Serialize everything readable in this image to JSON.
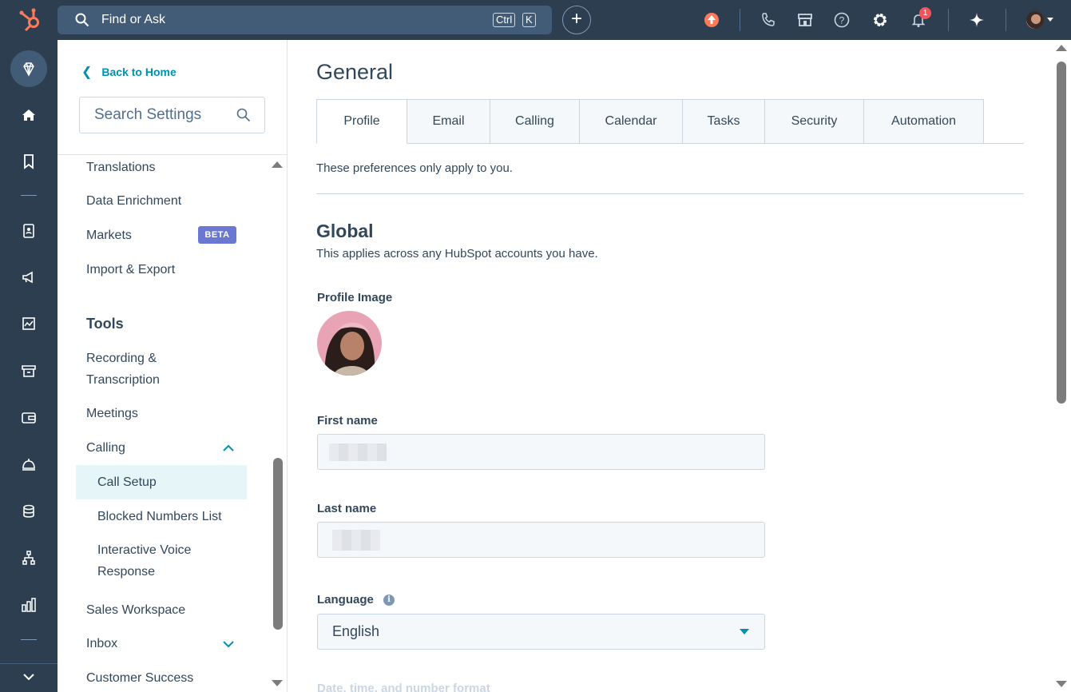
{
  "topbar": {
    "search_text": "Find or Ask",
    "shortcut_ctrl": "Ctrl",
    "shortcut_k": "K",
    "notification_count": "1",
    "icons": [
      "upgrade-icon",
      "phone-icon",
      "marketplace-icon",
      "help-icon",
      "settings-icon",
      "bell-icon",
      "ai-sparkle-icon",
      "account-avatar"
    ]
  },
  "leftnav": {
    "icons": [
      "hubspot-logo",
      "diamond-icon",
      "home-icon",
      "bookmark-icon",
      "contacts-icon",
      "marketing-icon",
      "content-icon",
      "commerce-icon",
      "payments-icon",
      "service-icon",
      "data-icon",
      "automation-icon",
      "reporting-icon",
      "collapse-icon"
    ]
  },
  "sidebar": {
    "back_label": "Back to Home",
    "search_placeholder": "Search Settings",
    "items": [
      {
        "label": "Translations"
      },
      {
        "label": "Data Enrichment"
      },
      {
        "label": "Markets",
        "badge": "BETA"
      },
      {
        "label": "Import & Export"
      }
    ],
    "tools_heading": "Tools",
    "tools_items": [
      {
        "label": "Recording &"
      },
      {
        "label": "Transcription"
      },
      {
        "label": "Meetings"
      },
      {
        "label": "Calling"
      },
      {
        "label": "Call Setup"
      },
      {
        "label": "Blocked Numbers List"
      },
      {
        "label": "Interactive Voice"
      },
      {
        "label": "Response"
      },
      {
        "label": "Sales Workspace"
      },
      {
        "label": "Inbox"
      },
      {
        "label": "Customer Success"
      }
    ]
  },
  "main": {
    "title": "General",
    "tabs": [
      {
        "label": "Profile"
      },
      {
        "label": "Email"
      },
      {
        "label": "Calling"
      },
      {
        "label": "Calendar"
      },
      {
        "label": "Tasks"
      },
      {
        "label": "Security"
      },
      {
        "label": "Automation"
      }
    ],
    "prefs_note": "These preferences only apply to you.",
    "global_heading": "Global",
    "global_desc": "This applies across any HubSpot accounts you have.",
    "profile_image_label": "Profile Image",
    "first_name_label": "First name",
    "first_name_value": "",
    "last_name_label": "Last name",
    "last_name_value": "",
    "language_label": "Language",
    "language_value": "English",
    "date_format_label": "Date, time, and number format"
  },
  "colors": {
    "topbar_bg": "#2d3e50",
    "accent": "#0091ae",
    "beta_badge": "#6a78d1",
    "notification": "#f2545b",
    "upgrade": "#ff7a59"
  }
}
